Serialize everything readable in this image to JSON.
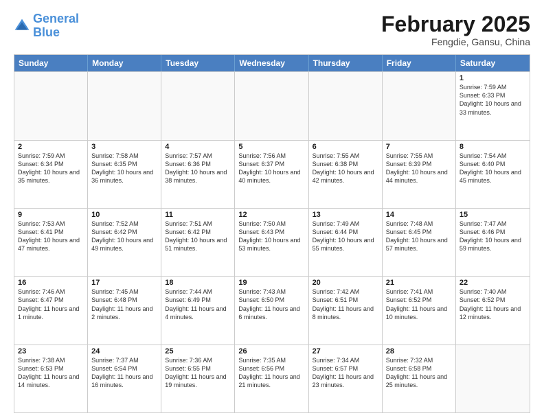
{
  "logo": {
    "line1": "General",
    "line2": "Blue"
  },
  "title": "February 2025",
  "subtitle": "Fengdie, Gansu, China",
  "days": [
    "Sunday",
    "Monday",
    "Tuesday",
    "Wednesday",
    "Thursday",
    "Friday",
    "Saturday"
  ],
  "weeks": [
    [
      {
        "day": "",
        "text": ""
      },
      {
        "day": "",
        "text": ""
      },
      {
        "day": "",
        "text": ""
      },
      {
        "day": "",
        "text": ""
      },
      {
        "day": "",
        "text": ""
      },
      {
        "day": "",
        "text": ""
      },
      {
        "day": "1",
        "text": "Sunrise: 7:59 AM\nSunset: 6:33 PM\nDaylight: 10 hours and 33 minutes."
      }
    ],
    [
      {
        "day": "2",
        "text": "Sunrise: 7:59 AM\nSunset: 6:34 PM\nDaylight: 10 hours and 35 minutes."
      },
      {
        "day": "3",
        "text": "Sunrise: 7:58 AM\nSunset: 6:35 PM\nDaylight: 10 hours and 36 minutes."
      },
      {
        "day": "4",
        "text": "Sunrise: 7:57 AM\nSunset: 6:36 PM\nDaylight: 10 hours and 38 minutes."
      },
      {
        "day": "5",
        "text": "Sunrise: 7:56 AM\nSunset: 6:37 PM\nDaylight: 10 hours and 40 minutes."
      },
      {
        "day": "6",
        "text": "Sunrise: 7:55 AM\nSunset: 6:38 PM\nDaylight: 10 hours and 42 minutes."
      },
      {
        "day": "7",
        "text": "Sunrise: 7:55 AM\nSunset: 6:39 PM\nDaylight: 10 hours and 44 minutes."
      },
      {
        "day": "8",
        "text": "Sunrise: 7:54 AM\nSunset: 6:40 PM\nDaylight: 10 hours and 45 minutes."
      }
    ],
    [
      {
        "day": "9",
        "text": "Sunrise: 7:53 AM\nSunset: 6:41 PM\nDaylight: 10 hours and 47 minutes."
      },
      {
        "day": "10",
        "text": "Sunrise: 7:52 AM\nSunset: 6:42 PM\nDaylight: 10 hours and 49 minutes."
      },
      {
        "day": "11",
        "text": "Sunrise: 7:51 AM\nSunset: 6:42 PM\nDaylight: 10 hours and 51 minutes."
      },
      {
        "day": "12",
        "text": "Sunrise: 7:50 AM\nSunset: 6:43 PM\nDaylight: 10 hours and 53 minutes."
      },
      {
        "day": "13",
        "text": "Sunrise: 7:49 AM\nSunset: 6:44 PM\nDaylight: 10 hours and 55 minutes."
      },
      {
        "day": "14",
        "text": "Sunrise: 7:48 AM\nSunset: 6:45 PM\nDaylight: 10 hours and 57 minutes."
      },
      {
        "day": "15",
        "text": "Sunrise: 7:47 AM\nSunset: 6:46 PM\nDaylight: 10 hours and 59 minutes."
      }
    ],
    [
      {
        "day": "16",
        "text": "Sunrise: 7:46 AM\nSunset: 6:47 PM\nDaylight: 11 hours and 1 minute."
      },
      {
        "day": "17",
        "text": "Sunrise: 7:45 AM\nSunset: 6:48 PM\nDaylight: 11 hours and 2 minutes."
      },
      {
        "day": "18",
        "text": "Sunrise: 7:44 AM\nSunset: 6:49 PM\nDaylight: 11 hours and 4 minutes."
      },
      {
        "day": "19",
        "text": "Sunrise: 7:43 AM\nSunset: 6:50 PM\nDaylight: 11 hours and 6 minutes."
      },
      {
        "day": "20",
        "text": "Sunrise: 7:42 AM\nSunset: 6:51 PM\nDaylight: 11 hours and 8 minutes."
      },
      {
        "day": "21",
        "text": "Sunrise: 7:41 AM\nSunset: 6:52 PM\nDaylight: 11 hours and 10 minutes."
      },
      {
        "day": "22",
        "text": "Sunrise: 7:40 AM\nSunset: 6:52 PM\nDaylight: 11 hours and 12 minutes."
      }
    ],
    [
      {
        "day": "23",
        "text": "Sunrise: 7:38 AM\nSunset: 6:53 PM\nDaylight: 11 hours and 14 minutes."
      },
      {
        "day": "24",
        "text": "Sunrise: 7:37 AM\nSunset: 6:54 PM\nDaylight: 11 hours and 16 minutes."
      },
      {
        "day": "25",
        "text": "Sunrise: 7:36 AM\nSunset: 6:55 PM\nDaylight: 11 hours and 19 minutes."
      },
      {
        "day": "26",
        "text": "Sunrise: 7:35 AM\nSunset: 6:56 PM\nDaylight: 11 hours and 21 minutes."
      },
      {
        "day": "27",
        "text": "Sunrise: 7:34 AM\nSunset: 6:57 PM\nDaylight: 11 hours and 23 minutes."
      },
      {
        "day": "28",
        "text": "Sunrise: 7:32 AM\nSunset: 6:58 PM\nDaylight: 11 hours and 25 minutes."
      },
      {
        "day": "",
        "text": ""
      }
    ]
  ]
}
